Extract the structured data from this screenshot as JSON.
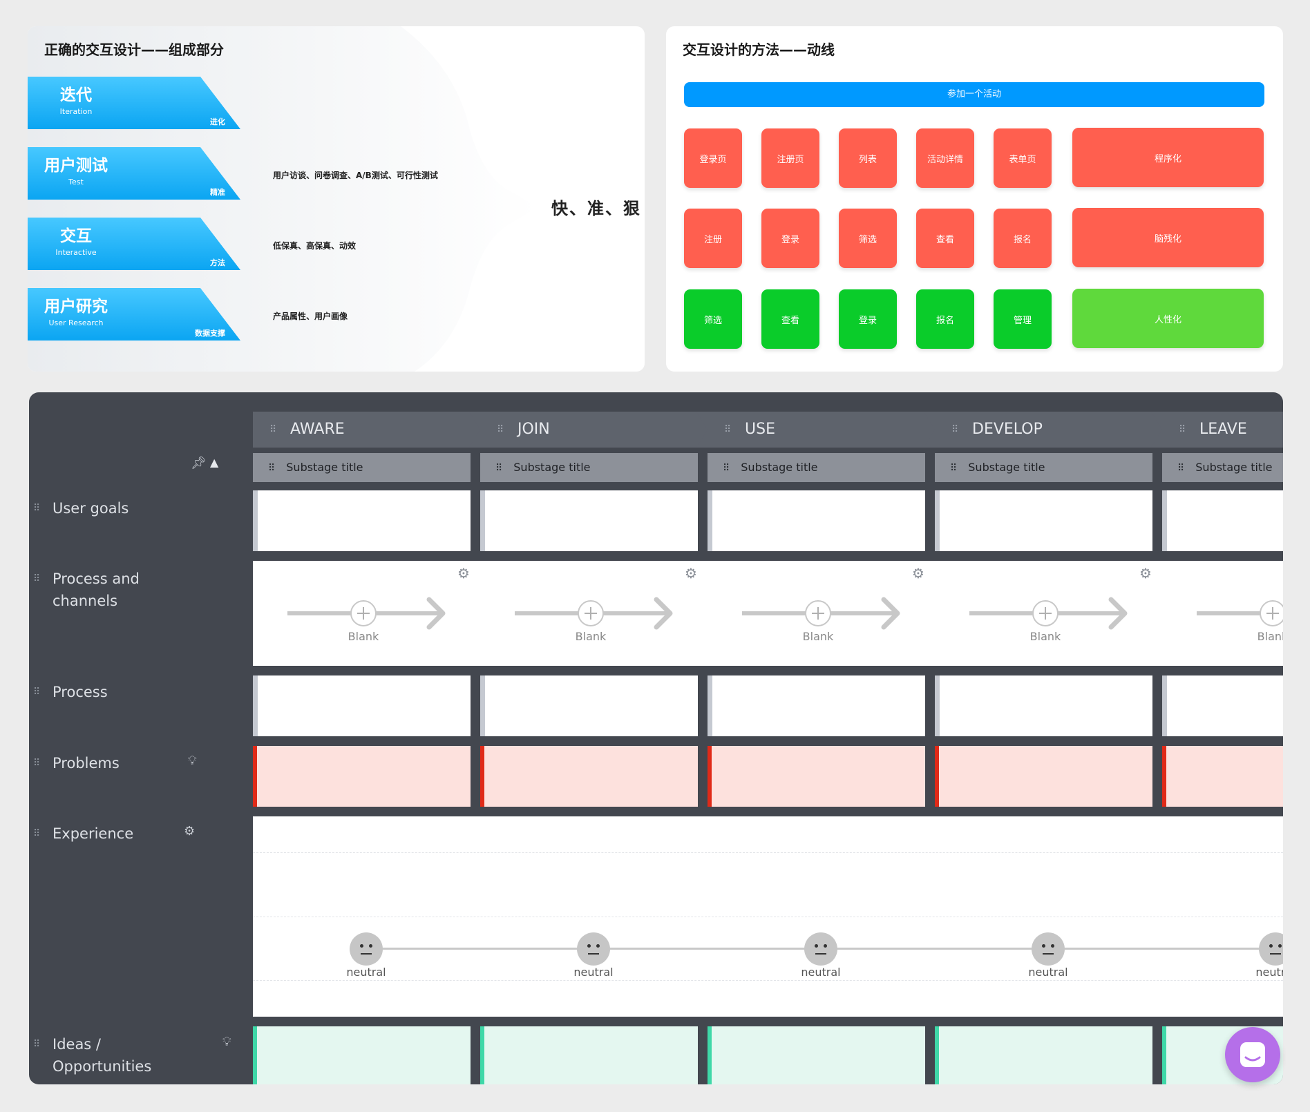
{
  "left_panel": {
    "title": "正确的交互设计——组成部分",
    "layers": [
      {
        "title": "迭代",
        "subtitle": "Iteration",
        "right": "进化",
        "desc": ""
      },
      {
        "title": "用户测试",
        "subtitle": "Test",
        "right": "精准",
        "desc": "用户访谈、问卷调查、A/B测试、可行性测试"
      },
      {
        "title": "交互",
        "subtitle": "Interactive",
        "right": "方法",
        "desc": "低保真、高保真、动效"
      },
      {
        "title": "用户研究",
        "subtitle": "User Research",
        "right": "数据支撑",
        "desc": "产品属性、用户画像"
      }
    ],
    "result": "快、准、狠"
  },
  "right_panel": {
    "title": "交互设计的方法——动线",
    "top_bar": "参加一个活动",
    "rows": [
      {
        "tiles": [
          "登录页",
          "注册页",
          "列表",
          "活动详情",
          "表单页"
        ],
        "wide": "程序化",
        "color": "#ff5f4f"
      },
      {
        "tiles": [
          "注册",
          "登录",
          "筛选",
          "查看",
          "报名"
        ],
        "wide": "脑残化",
        "color": "#ff5f4f"
      },
      {
        "tiles": [
          "筛选",
          "查看",
          "登录",
          "报名",
          "管理"
        ],
        "wide": "人性化",
        "color": "#0acc2a"
      }
    ]
  },
  "journey": {
    "stages": [
      "AWARE",
      "JOIN",
      "USE",
      "DEVELOP",
      "LEAVE"
    ],
    "substage": "Substage title",
    "rows": [
      "User goals",
      "Process and channels",
      "Process",
      "Problems",
      "Experience",
      "Ideas / Opportunities"
    ],
    "process_label": "Blank",
    "experience_label": "neutral",
    "icons": {
      "pin": "pin-icon",
      "collapse": "triangle-up-icon",
      "gear": "gear-icon",
      "bulb": "lightbulb-icon",
      "chat": "chat-icon"
    }
  }
}
